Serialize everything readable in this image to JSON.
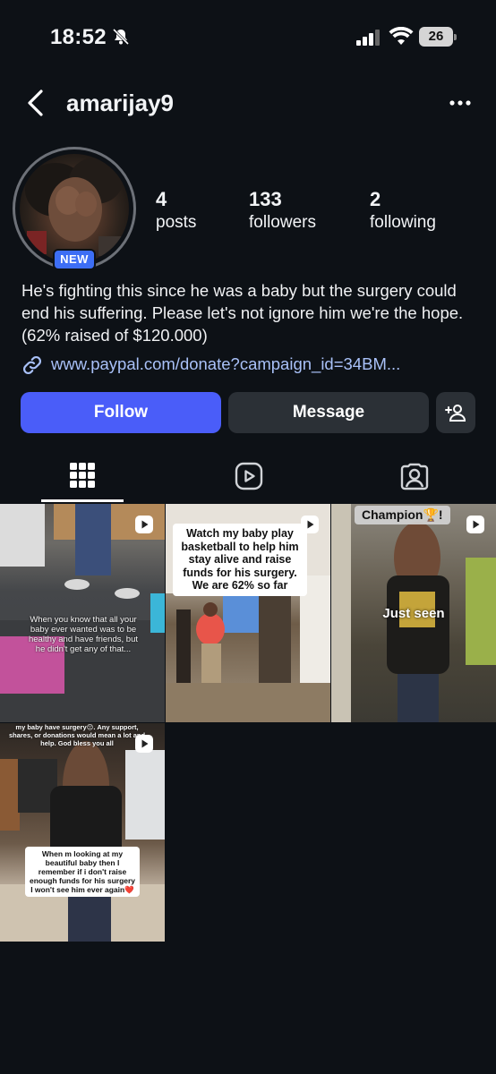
{
  "status_bar": {
    "time": "18:52",
    "battery": "26"
  },
  "header": {
    "username": "amarijay9"
  },
  "profile": {
    "badge": "NEW",
    "stats": [
      {
        "value": "4",
        "label": "posts"
      },
      {
        "value": "133",
        "label": "followers"
      },
      {
        "value": "2",
        "label": "following"
      }
    ],
    "bio": "He's fighting this since he was a baby but the surgery could end his suffering. Please let's not ignore him we're the hope. (62% raised of $120.000)",
    "link": "www.paypal.com/donate?campaign_id=34BM..."
  },
  "actions": {
    "follow": "Follow",
    "message": "Message"
  },
  "tabs": [
    {
      "name": "grid-icon"
    },
    {
      "name": "reels-icon"
    },
    {
      "name": "tagged-icon"
    }
  ],
  "posts": [
    {
      "caption": "When you know that all your baby ever wanted was to be healthy and have friends, but he didn't get any of that..."
    },
    {
      "caption": "Watch my baby play basketball to help him stay alive and raise funds for his surgery. We are 62% so far"
    },
    {
      "top_label": "Champion🏆!",
      "caption": "Just seen"
    },
    {
      "top_caption": "my baby have surgery😔. Any support, shares, or donations would mean a lot and help. God bless you all",
      "caption": "When m looking at my beautiful baby then I remember if i don't raise enough funds for his surgery I won't see him ever again❤️"
    }
  ],
  "colors": {
    "background": "#0d1116",
    "follow_button": "#4a5df9",
    "secondary_button": "#2b3036",
    "link": "#a9c1f8",
    "badge": "#3d6ef5"
  }
}
